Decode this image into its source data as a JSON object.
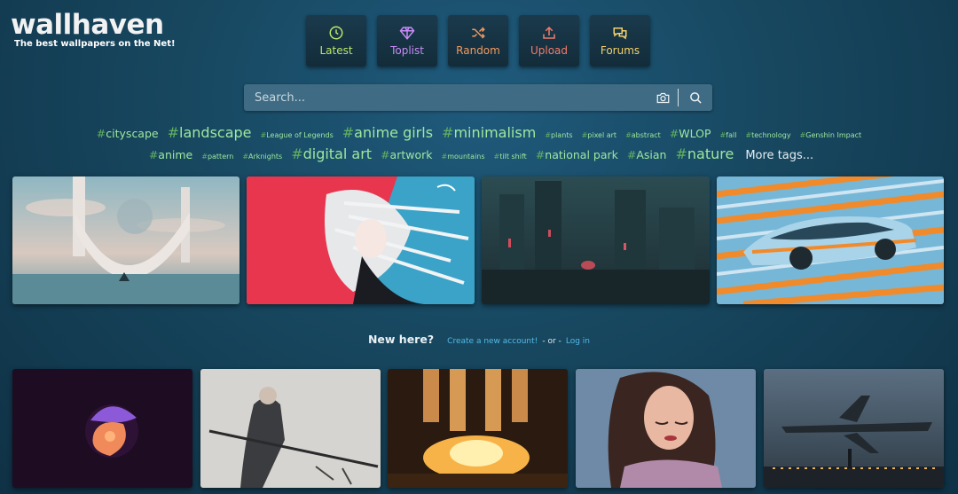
{
  "header": {
    "logo": "wallhaven",
    "tagline": "The best wallpapers on the Net!"
  },
  "nav": [
    {
      "label": "Latest",
      "icon": "clock-icon",
      "color": "#b9e66b"
    },
    {
      "label": "Toplist",
      "icon": "diamond-icon",
      "color": "#c78cf5"
    },
    {
      "label": "Random",
      "icon": "shuffle-icon",
      "color": "#f29a5f"
    },
    {
      "label": "Upload",
      "icon": "upload-icon",
      "color": "#f27c6a"
    },
    {
      "label": "Forums",
      "icon": "chat-icon",
      "color": "#f5d26b"
    }
  ],
  "search": {
    "placeholder": "Search...",
    "camera_icon": "camera-icon",
    "search_icon": "search-icon"
  },
  "tags_row1": [
    {
      "name": "cityscape",
      "size": "m"
    },
    {
      "name": "landscape",
      "size": "l"
    },
    {
      "name": "League of Legends",
      "size": "s"
    },
    {
      "name": "anime girls",
      "size": "l"
    },
    {
      "name": "minimalism",
      "size": "l"
    },
    {
      "name": "plants",
      "size": "s"
    },
    {
      "name": "pixel art",
      "size": "s"
    },
    {
      "name": "abstract",
      "size": "s"
    },
    {
      "name": "WLOP",
      "size": "m"
    },
    {
      "name": "fall",
      "size": "s"
    },
    {
      "name": "technology",
      "size": "s"
    },
    {
      "name": "Genshin Impact",
      "size": "s"
    }
  ],
  "tags_row2": [
    {
      "name": "anime",
      "size": "m"
    },
    {
      "name": "pattern",
      "size": "s"
    },
    {
      "name": "Arknights",
      "size": "s"
    },
    {
      "name": "digital art",
      "size": "l"
    },
    {
      "name": "artwork",
      "size": "m"
    },
    {
      "name": "mountains",
      "size": "s"
    },
    {
      "name": "tilt shift",
      "size": "s"
    },
    {
      "name": "national park",
      "size": "m"
    },
    {
      "name": "Asian",
      "size": "m"
    },
    {
      "name": "nature",
      "size": "l"
    }
  ],
  "more_tags": "More tags...",
  "newhere": {
    "question": "New here?",
    "create_link": "Create a new account!",
    "separator": "- or -",
    "login_link": "Log in"
  },
  "colors": {
    "tag_green": "#9fe89f",
    "link_blue": "#52b9e6",
    "search_bg": "#3f6c84"
  }
}
